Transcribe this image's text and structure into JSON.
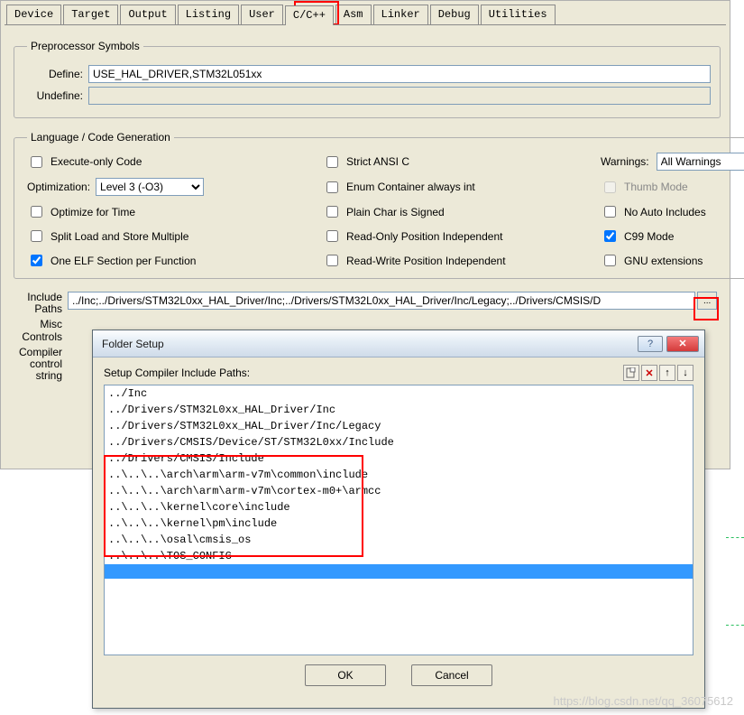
{
  "tabs": [
    "Device",
    "Target",
    "Output",
    "Listing",
    "User",
    "C/C++",
    "Asm",
    "Linker",
    "Debug",
    "Utilities"
  ],
  "active_tab_index": 5,
  "preproc": {
    "legend": "Preprocessor Symbols",
    "define_label": "Define:",
    "define_value": "USE_HAL_DRIVER,STM32L051xx",
    "undefine_label": "Undefine:",
    "undefine_value": ""
  },
  "lang": {
    "legend": "Language / Code Generation",
    "execute_only": "Execute-only Code",
    "strict_ansi": "Strict ANSI C",
    "warnings_label": "Warnings:",
    "warnings_value": "All Warnings",
    "optimization_label": "Optimization:",
    "optimization_value": "Level 3 (-O3)",
    "enum_container": "Enum Container always int",
    "thumb_mode": "Thumb Mode",
    "optimize_time": "Optimize for Time",
    "plain_char": "Plain Char is Signed",
    "no_auto_inc": "No Auto Includes",
    "split_load": "Split Load and Store Multiple",
    "ro_pi": "Read-Only Position Independent",
    "c99_mode": "C99 Mode",
    "one_elf": "One ELF Section per Function",
    "rw_pi": "Read-Write Position Independent",
    "gnu_ext": "GNU extensions",
    "checked": {
      "one_elf": true,
      "c99_mode": true
    }
  },
  "include": {
    "label": "Include\nPaths",
    "value": "../Inc;../Drivers/STM32L0xx_HAL_Driver/Inc;../Drivers/STM32L0xx_HAL_Driver/Inc/Legacy;../Drivers/CMSIS/D",
    "browse": "..."
  },
  "misc": {
    "label": "Misc\nControls"
  },
  "compiler": {
    "label": "Compiler\ncontrol\nstring"
  },
  "dialog": {
    "title": "Folder Setup",
    "caption": "Setup Compiler Include Paths:",
    "tools": {
      "new": "new-icon",
      "delete": "✕",
      "up": "↑",
      "down": "↓"
    },
    "items": [
      "../Inc",
      "../Drivers/STM32L0xx_HAL_Driver/Inc",
      "../Drivers/STM32L0xx_HAL_Driver/Inc/Legacy",
      "../Drivers/CMSIS/Device/ST/STM32L0xx/Include",
      "../Drivers/CMSIS/Include",
      "..\\..\\..\\arch\\arm\\arm-v7m\\common\\include",
      "..\\..\\..\\arch\\arm\\arm-v7m\\cortex-m0+\\armcc",
      "..\\..\\..\\kernel\\core\\include",
      "..\\..\\..\\kernel\\pm\\include",
      "..\\..\\..\\osal\\cmsis_os",
      "..\\..\\..\\TOS_CONFIG"
    ],
    "selected_index": 11,
    "ok": "OK",
    "cancel": "Cancel"
  },
  "watermark": "https://blog.csdn.net/qq_36075612"
}
